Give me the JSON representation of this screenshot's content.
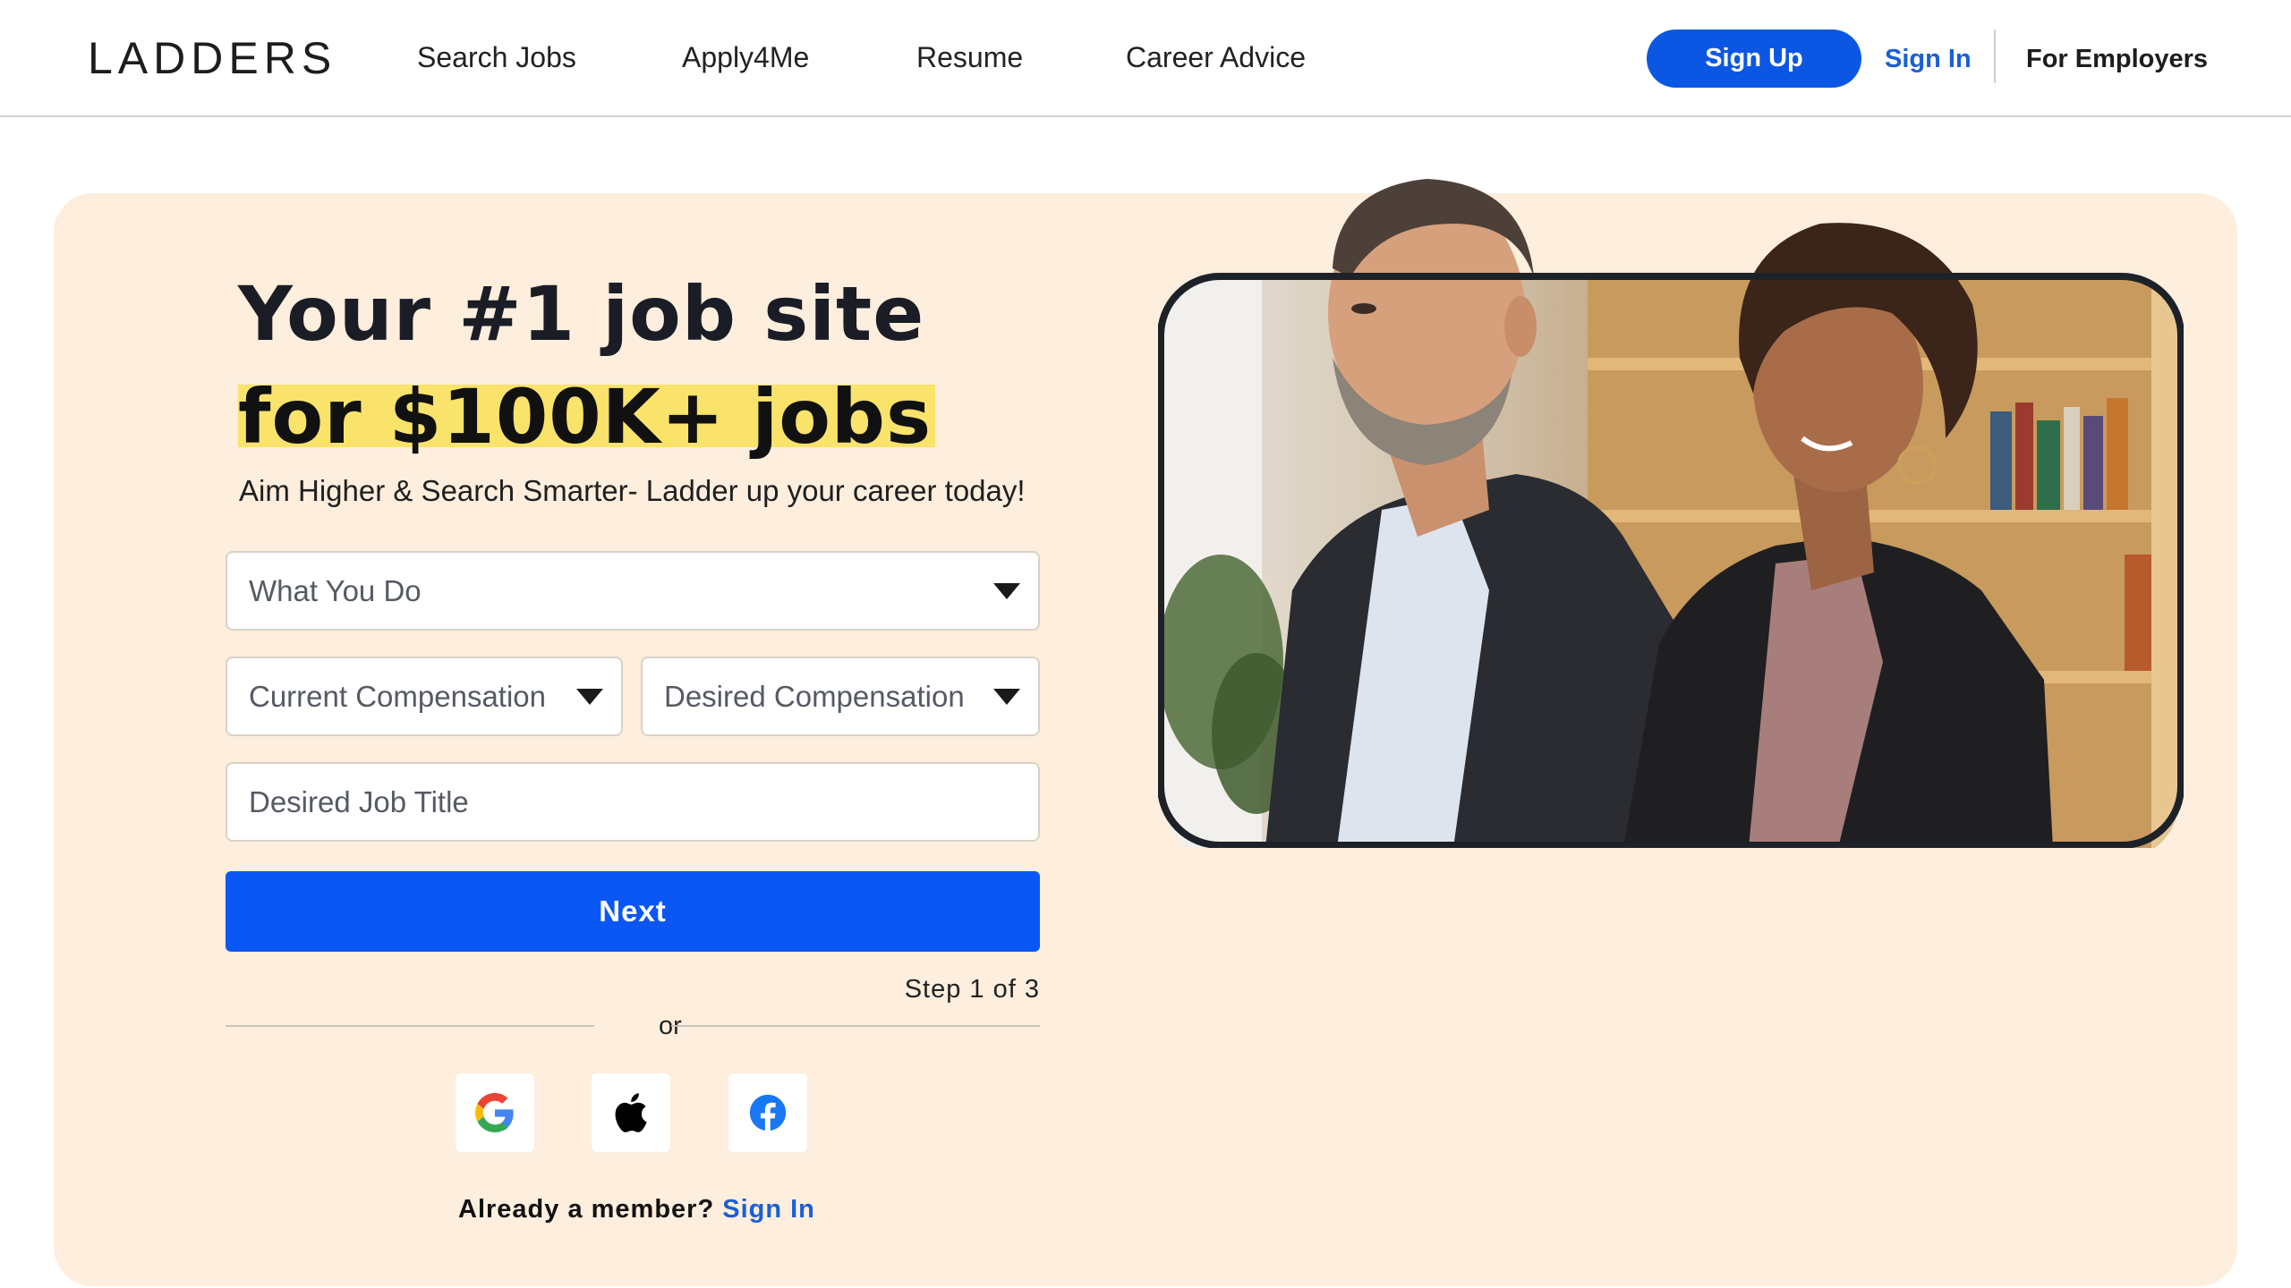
{
  "header": {
    "logo": "LADDERS",
    "nav": [
      "Search Jobs",
      "Apply4Me",
      "Resume",
      "Career Advice"
    ],
    "sign_up": "Sign Up",
    "sign_in": "Sign In",
    "for_employers": "For Employers"
  },
  "hero": {
    "title_line1": "Your #1 job site",
    "title_line2": "for $100K+ jobs",
    "subtitle": "Aim Higher & Search Smarter- Ladder up your career today!",
    "form": {
      "what_you_do": "What You Do",
      "current_compensation": "Current Compensation",
      "desired_compensation": "Desired Compensation",
      "desired_job_title_placeholder": "Desired Job Title",
      "next_label": "Next",
      "step_text": "Step 1 of 3",
      "or_label": "or"
    },
    "social": [
      {
        "name": "google",
        "icon": "google-icon"
      },
      {
        "name": "apple",
        "icon": "apple-icon"
      },
      {
        "name": "facebook",
        "icon": "facebook-icon"
      }
    ],
    "already_member": "Already a member?",
    "member_sign_in": "Sign In"
  },
  "colors": {
    "brand_blue": "#0b57e3",
    "hero_bg": "#fdeedd",
    "highlight": "#f9e36b"
  }
}
